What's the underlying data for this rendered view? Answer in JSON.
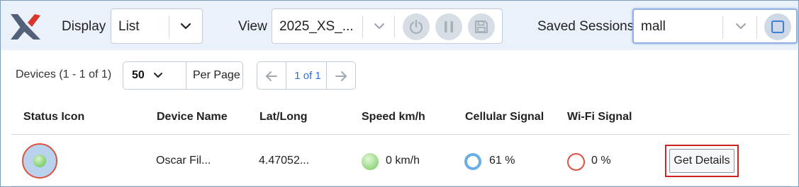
{
  "toolbar": {
    "display_label": "Display",
    "display_value": "List",
    "view_label": "View",
    "view_value": "2025_XS_...",
    "saved_sessions_label": "Saved Sessions",
    "saved_sessions_value": "mall"
  },
  "pagination": {
    "devices_count": "Devices (1 - 1 of 1)",
    "per_page_value": "50",
    "per_page_label": "Per Page",
    "page_indicator": "1 of 1"
  },
  "table": {
    "headers": [
      "Status Icon",
      "Device Name",
      "Lat/Long",
      "Speed km/h",
      "Cellular Signal",
      "Wi-Fi Signal"
    ],
    "rows": [
      {
        "device_name": "Oscar Fil...",
        "lat_long": "4.47052...",
        "speed": "0 km/h",
        "cellular": "61 %",
        "wifi": "0 %",
        "action": "Get Details"
      }
    ]
  },
  "colors": {
    "toolbar_bg": "#eaf1fa",
    "accent_blue": "#2f6fce",
    "alert_red": "#e05040",
    "ok_green": "#8bd47a",
    "signal_blue": "#6aaee8"
  }
}
